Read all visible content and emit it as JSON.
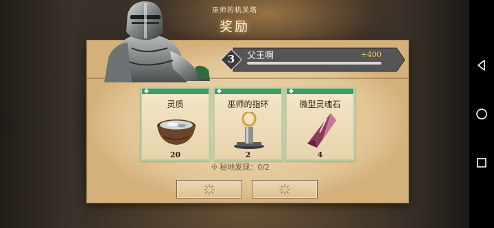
{
  "header": {
    "subtitle": "巫师的机关塔",
    "title": "奖励"
  },
  "progress": {
    "level": "3",
    "name": "父王啊",
    "xp_gain": "+400",
    "bar_fill_percent": 100
  },
  "rewards": [
    {
      "label": "灵质",
      "quantity": "20",
      "icon": "ectoplasm-bowl-icon"
    },
    {
      "label": "巫师的指环",
      "quantity": "2",
      "icon": "wizard-ring-icon"
    },
    {
      "label": "微型灵魂石",
      "quantity": "4",
      "icon": "soul-crystal-icon"
    }
  ],
  "secret": {
    "label": "秘地发现：0/2"
  },
  "buttons": [
    {
      "icon": "loading-spinner-icon"
    },
    {
      "icon": "loading-spinner-icon"
    }
  ],
  "navbar": {
    "icons": [
      "back-triangle-icon",
      "home-circle-icon",
      "recents-square-icon"
    ]
  },
  "colors": {
    "card_accent": "#3d9c62",
    "xp_text": "#f2c34f",
    "ribbon": "#5a5a5a"
  }
}
